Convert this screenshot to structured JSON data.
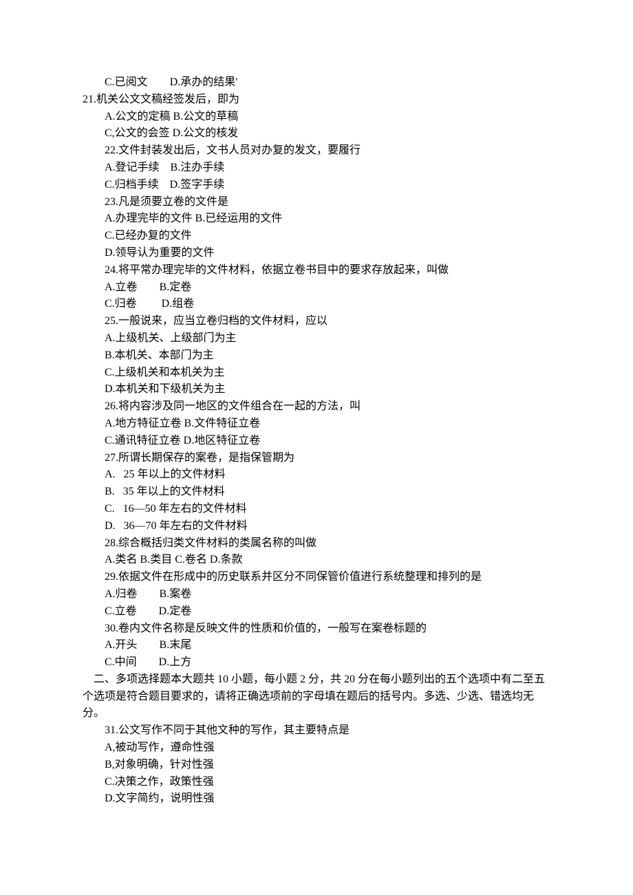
{
  "q20_options": {
    "c": "C.已阅文",
    "d": "D.承办的结果'"
  },
  "q21": {
    "stem": "21.机关公文文稿经签发后，即为",
    "row1": "A.公文的定稿 B.公文的草稿",
    "row2": "C,公文的会签 D.公文的核发"
  },
  "q22": {
    "stem": "22.文件封装发出后，文书人员对办复的发文，要履行",
    "row1": "A.登记手续    B.注办手续",
    "row2": "C.归档手续    D.签字手续"
  },
  "q23": {
    "stem": "23.凡是须要立卷的文件是",
    "row1": "A.办理完毕的文件 B.已经运用的文件",
    "row2": "C.已经办复的文件",
    "row3": "D.领导认为重要的文件"
  },
  "q24": {
    "stem": "24.将平常办理完毕的文件材料，依据立卷书目中的要求存放起来，叫做",
    "row1": "A.立卷        B.定卷",
    "row2": "C.归卷         D.组卷"
  },
  "q25": {
    "stem": "25.一般说来，应当立卷归档的文件材料，应以",
    "a": "A.上级机关、上级部门为主",
    "b": "B.本机关、本部门为主",
    "c": "C.上级机关和本机关为主",
    "d": "D.本机关和下级机关为主"
  },
  "q26": {
    "stem": "26.将内容涉及同一地区的文件组合在一起的方法，叫",
    "row1": "A.地方特征立卷 B.文件特征立卷",
    "row2": "C.通讯特征立卷 D.地区特征立卷"
  },
  "q27": {
    "stem": "27.所谓长期保存的案卷，是指保管期为",
    "a": "A.   25 年以上的文件材料",
    "b": "B.   35 年以上的文件材料",
    "c": "C.   16—50 年左右的文件材料",
    "d": "D.   36—70 年左右的文件材料"
  },
  "q28": {
    "stem": "28.综合概括归类文件材料的类属名称的叫做",
    "row1": "A.类名 B.类目 C.卷名 D.条款"
  },
  "q29": {
    "stem": "29.依据文件在形成中的历史联系并区分不同保管价值进行系统整理和排列的是",
    "row1": "A.归卷        B.案卷",
    "row2": "C.立卷        D.定卷"
  },
  "q30": {
    "stem": "30.卷内文件名称是反映文件的性质和价值的，一般写在案卷标题的",
    "row1": "A.开头        B.末尾",
    "row2": "C.中间        D.上方"
  },
  "section2": {
    "intro": "    二、多项选择题本大题共 10 小题，每小题 2 分，共 20 分在每小题列出的五个选项中有二至五个选项是符合题目要求的，请将正确选项前的字母填在题后的括号内。多选、少选、错选均无分。"
  },
  "q31": {
    "stem": "31.公文写作不同于其他文种的写作，其主要特点是",
    "a": "A,被动写作，遵命性强",
    "b": "B,对象明确，针对性强",
    "c": "C.决策之作，政策性强",
    "d": "D.文字简约，说明性强"
  }
}
